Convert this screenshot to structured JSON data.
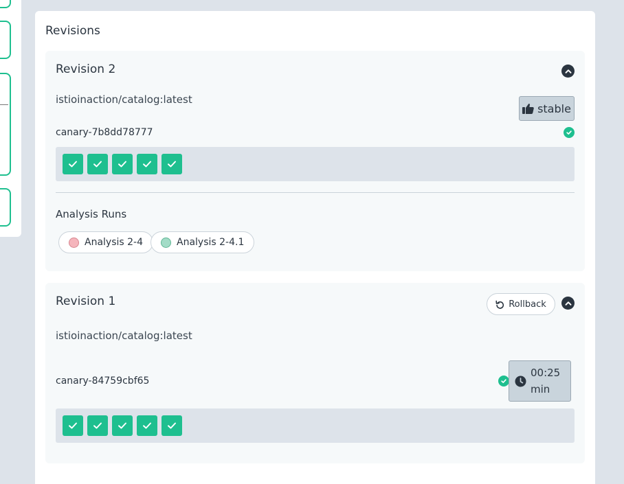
{
  "panel": {
    "title": "Revisions"
  },
  "revisions": [
    {
      "title": "Revision 2",
      "image": "istioinaction/catalog:latest",
      "replicaset": "canary-7b8dd78777",
      "badge": "stable",
      "pods": [
        "ok",
        "ok",
        "ok",
        "ok",
        "ok"
      ],
      "analysis_title": "Analysis Runs",
      "analysis_runs": [
        {
          "label": "Analysis 2-4",
          "status": "failed",
          "color": "#f5b5bc"
        },
        {
          "label": "Analysis 2-4.1",
          "status": "successful",
          "color": "#a3dcc7"
        }
      ]
    },
    {
      "title": "Revision 1",
      "image": "istioinaction/catalog:latest",
      "replicaset": "canary-84759cbf65",
      "rollback_label": "Rollback",
      "timer_value": "00:25",
      "timer_unit": "min",
      "pods": [
        "ok",
        "ok",
        "ok",
        "ok",
        "ok"
      ]
    }
  ],
  "colors": {
    "success": "#1ebf8f",
    "dark": "#2b3540",
    "badge_bg": "#c9d4dc"
  },
  "icons": {
    "collapse": "chevron-up-icon",
    "stable": "thumbs-up-icon",
    "rollback": "undo-icon",
    "timer": "clock-icon",
    "pod": "check-icon",
    "healthy": "check-circle-icon"
  }
}
